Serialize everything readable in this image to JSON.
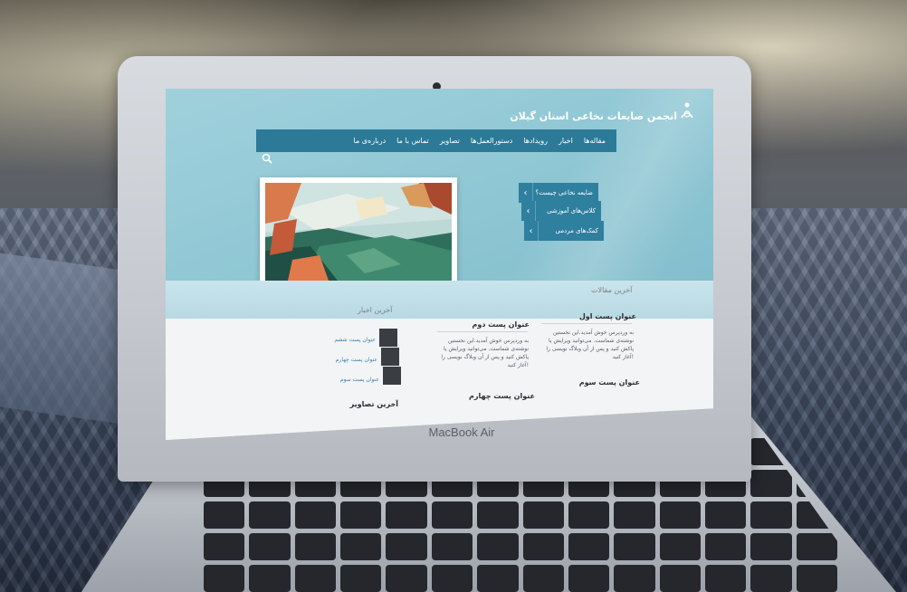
{
  "device": {
    "brand": "MacBook Air"
  },
  "site": {
    "title": "انجمن ضایعات نخاعی استان گیلان",
    "nav": [
      "مقاله‌ها",
      "اخبار",
      "رویدادها",
      "دستورالعمل‌ها",
      "تصاویر",
      "تماس با ما",
      "درباره‌ی ما"
    ],
    "side_buttons": [
      "ضایعه نخاعی چیست؟",
      "کلاس‌های آموزشی",
      "کمک‌های مردمی"
    ],
    "sections": {
      "articles": "آخرین مقالات",
      "news": "آخرین اخبار",
      "images": "آخرین تصاویر"
    },
    "posts": [
      {
        "title": "عنوان پست اول",
        "body": "به وردپرس خوش آمدید.این نخستین نوشته‌ی شماست. می‌توانید ویرایش یا پاکش کنید و پس از آن وبلاگ نویسی را آغاز کنید!"
      },
      {
        "title": "عنوان پست دوم",
        "body": "به وردپرس خوش آمدید.این نخستین نوشته‌ی شماست. می‌توانید ویرایش یا پاکش کنید و پس از آن وبلاگ نویسی را آغاز کنید!"
      },
      {
        "title": "عنوان پست سوم"
      },
      {
        "title": "عنوان پست چهارم"
      }
    ],
    "news": [
      "عنوان پست ششم",
      "عنوان پست چهارم",
      "عنوان پست سوم"
    ]
  }
}
